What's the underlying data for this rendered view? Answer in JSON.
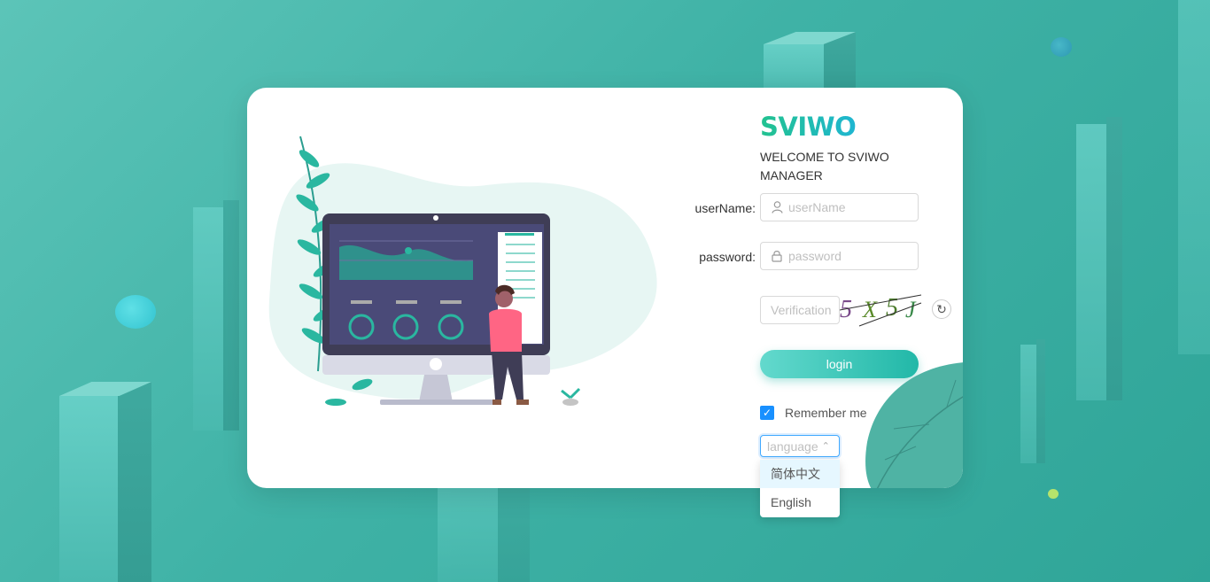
{
  "brand": {
    "logo": "SVIWO",
    "welcome": "WELCOME TO SVIWO MANAGER"
  },
  "form": {
    "username_label": "userName:",
    "username_placeholder": "userName",
    "password_label": "password:",
    "password_placeholder": "password",
    "verification_placeholder": "Verification",
    "captcha_text": "5X5J",
    "login_label": "login",
    "remember_label": "Remember me",
    "remember_checked": true
  },
  "language": {
    "placeholder": "language",
    "options": [
      "简体中文",
      "English"
    ],
    "highlighted": "简体中文"
  },
  "colors": {
    "accent": "#22b8a8",
    "background": "#3fb2a6",
    "checkbox": "#1890ff"
  }
}
